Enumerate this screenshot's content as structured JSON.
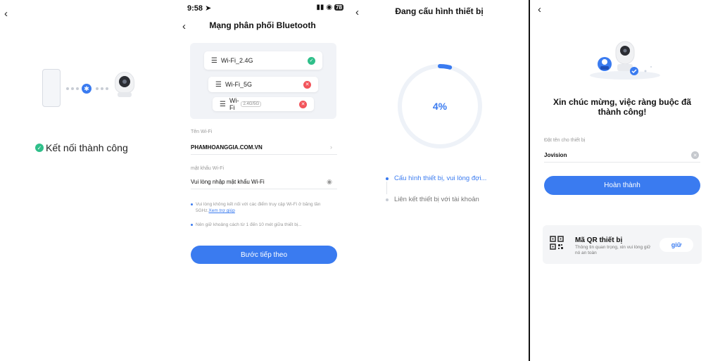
{
  "panel1": {
    "success_text": "Kết nối thành công"
  },
  "panel2": {
    "status_time": "9:58",
    "battery": "78",
    "title": "Mạng phân phối Bluetooth",
    "wifi_examples": [
      {
        "name": "Wi-Fi_2.4G",
        "badge": "",
        "status": "ok"
      },
      {
        "name": "Wi-Fi_5G",
        "badge": "",
        "status": "bad"
      },
      {
        "name": "Wi-Fi",
        "badge": "2.4G/5G",
        "status": "bad"
      }
    ],
    "wifi_name_label": "Tên Wi-Fi",
    "wifi_name_value": "PHAMHOANGGIA.COM.VN",
    "password_label": "mật khẩu Wi-Fi",
    "password_placeholder": "Vui lòng nhập mật khẩu Wi-Fi",
    "tip1_text": "Vui lòng không kết nối với các điểm truy cập Wi-Fi ở băng tần 5GHz.",
    "tip1_link": "Xem trợ giúp",
    "tip2_text": "Nên giữ khoảng cách từ 1 đến 10 mét giữa thiết bị...",
    "next_button": "Bước tiếp theo"
  },
  "panel3": {
    "title": "Đang cấu hình thiết bị",
    "progress_percent": 4,
    "progress_label": "4%",
    "step1": "Cấu hình thiết bị, vui lòng đợi...",
    "step2": "Liên kết thiết bị với tài khoản"
  },
  "panel4": {
    "title": "Xin chúc mừng, việc ràng buộc đã thành công!",
    "name_label": "Đặt tên cho thiết bị",
    "name_value": "Jovision",
    "done_button": "Hoàn thành",
    "qr_title": "Mã QR thiết bị",
    "qr_desc": "Thông tin quan trọng, xin vui lòng giữ nó an toàn",
    "qr_button": "giữ"
  },
  "colors": {
    "accent": "#3a7bf0",
    "success": "#2fbf8a",
    "error": "#f2545b"
  },
  "icons": {
    "back": "chevron-left-icon",
    "bluetooth": "bluetooth-icon",
    "wifi": "wifi-icon",
    "check": "check-circle-icon",
    "error": "close-circle-icon",
    "eye": "eye-icon",
    "qr": "qr-code-icon"
  }
}
